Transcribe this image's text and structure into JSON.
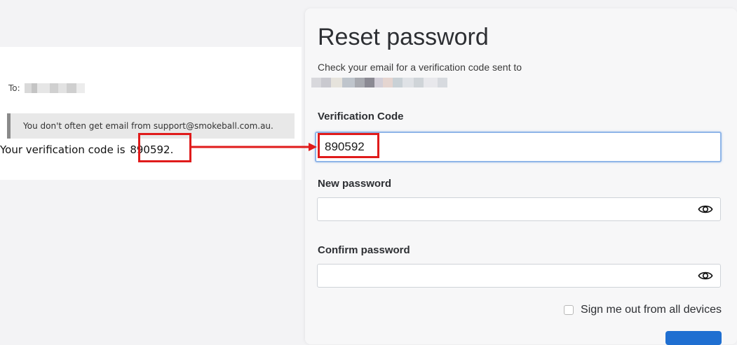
{
  "email": {
    "to_label": "To:",
    "warning_text": "You don't often get email from support@smokeball.com.au.",
    "code_text": "Your verification code is",
    "code_value": "890592."
  },
  "reset": {
    "title": "Reset password",
    "subtitle": "Check your email for a verification code sent to",
    "verification_label": "Verification Code",
    "verification_value": "890592",
    "new_password_label": "New password",
    "new_password_value": "",
    "confirm_password_label": "Confirm password",
    "confirm_password_value": "",
    "signout_label": "Sign me out from all devices",
    "signout_checked": false
  },
  "colors": {
    "annotation": "#e01b1b",
    "focus_border": "#8fb5e8",
    "primary_button": "#1f6fd1"
  },
  "icons": {
    "password_toggle": "eye-icon",
    "annotation_arrow": "arrow-right-icon"
  }
}
